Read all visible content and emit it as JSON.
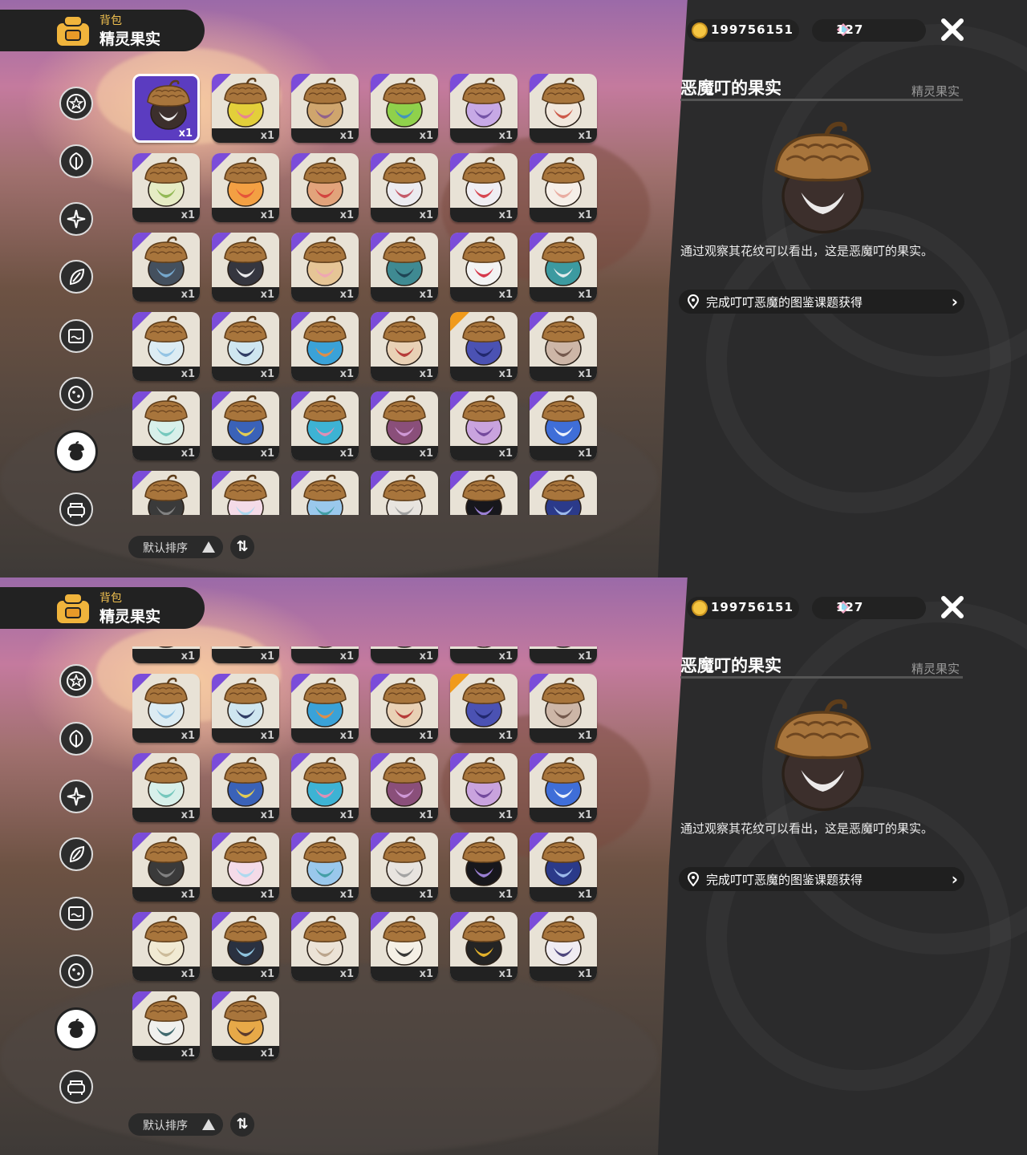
{
  "header": {
    "sub_label": "背包",
    "title": "精灵果实"
  },
  "currency": {
    "gold": "199756151",
    "gems": "127"
  },
  "tabs": [
    {
      "name": "tab-star",
      "icon": "star-badge-icon"
    },
    {
      "name": "tab-leaf",
      "icon": "leaf-icon"
    },
    {
      "name": "tab-spark",
      "icon": "sparkle-icon"
    },
    {
      "name": "tab-plant",
      "icon": "plant-icon"
    },
    {
      "name": "tab-scroll",
      "icon": "scroll-icon"
    },
    {
      "name": "tab-egg",
      "icon": "egg-icon"
    },
    {
      "name": "tab-fruit",
      "icon": "acorn-icon",
      "active": true
    },
    {
      "name": "tab-furniture",
      "icon": "sofa-icon"
    }
  ],
  "sort": {
    "label": "默认排序",
    "toggle": "⇅"
  },
  "detail": {
    "name": "恶魔叮的果实",
    "category": "精灵果实",
    "description": "通过观察其花纹可以看出，这是恶魔叮的果实。",
    "source": "完成叮叮恶魔的图鉴课题获得"
  },
  "items": [
    {
      "body": "#3c2f2c",
      "accent": "#ffffff",
      "corner": "none",
      "qty": "x1"
    },
    {
      "body": "#e3cf3a",
      "accent": "#e77c9a",
      "corner": "purple",
      "qty": "x1"
    },
    {
      "body": "#cfa56d",
      "accent": "#8a5a8e",
      "corner": "purple",
      "qty": "x1"
    },
    {
      "body": "#8fd14b",
      "accent": "#3a8dc9",
      "corner": "purple",
      "qty": "x1"
    },
    {
      "body": "#c7a9e6",
      "accent": "#6b4aa0",
      "corner": "purple",
      "qty": "x1"
    },
    {
      "body": "#f1e7dc",
      "accent": "#c94a3a",
      "corner": "purple",
      "qty": "x1"
    },
    {
      "body": "#e6ecc4",
      "accent": "#8ab44a",
      "corner": "purple",
      "qty": "x1"
    },
    {
      "body": "#f3a043",
      "accent": "#e34d38",
      "corner": "purple",
      "qty": "x1"
    },
    {
      "body": "#e2a37b",
      "accent": "#d23a3a",
      "corner": "purple",
      "qty": "x1"
    },
    {
      "body": "#ecebf0",
      "accent": "#c04a5a",
      "corner": "purple",
      "qty": "x1"
    },
    {
      "body": "#f0eef3",
      "accent": "#d43440",
      "corner": "purple",
      "qty": "x1"
    },
    {
      "body": "#f6efe8",
      "accent": "#e8a59a",
      "corner": "purple",
      "qty": "x1"
    },
    {
      "body": "#44505e",
      "accent": "#7bb0d8",
      "corner": "purple",
      "qty": "x1"
    },
    {
      "body": "#35363f",
      "accent": "#ffffff",
      "corner": "purple",
      "qty": "x1"
    },
    {
      "body": "#e6c596",
      "accent": "#f0a3b5",
      "corner": "purple",
      "qty": "x1"
    },
    {
      "body": "#3f8a92",
      "accent": "#1c3d4f",
      "corner": "purple",
      "qty": "x1"
    },
    {
      "body": "#f3f3f3",
      "accent": "#d3253a",
      "corner": "purple",
      "qty": "x1"
    },
    {
      "body": "#3c9aa0",
      "accent": "#f4f4f4",
      "corner": "purple",
      "qty": "x1"
    },
    {
      "body": "#dcecf3",
      "accent": "#8cc0e2",
      "corner": "purple",
      "qty": "x1"
    },
    {
      "body": "#cfe6f0",
      "accent": "#1f2a55",
      "corner": "purple",
      "qty": "x1"
    },
    {
      "body": "#3aa2d8",
      "accent": "#f08c3c",
      "corner": "purple",
      "qty": "x1"
    },
    {
      "body": "#e9d1b5",
      "accent": "#b02b2b",
      "corner": "purple",
      "qty": "x1"
    },
    {
      "body": "#4b52b3",
      "accent": "#1d2466",
      "corner": "gold",
      "qty": "x1"
    },
    {
      "body": "#cdb6a7",
      "accent": "#6a4f44",
      "corner": "purple",
      "qty": "x1"
    },
    {
      "body": "#d8f0ea",
      "accent": "#6bc3b8",
      "corner": "purple",
      "qty": "x1"
    },
    {
      "body": "#3a62b8",
      "accent": "#f5d84a",
      "corner": "purple",
      "qty": "x1"
    },
    {
      "body": "#3db3d4",
      "accent": "#f08cb3",
      "corner": "purple",
      "qty": "x1"
    },
    {
      "body": "#8a4f7a",
      "accent": "#d6a0e0",
      "corner": "purple",
      "qty": "x1"
    },
    {
      "body": "#c9a3de",
      "accent": "#6a4096",
      "corner": "purple",
      "qty": "x1"
    },
    {
      "body": "#3f6ed8",
      "accent": "#ffffff",
      "corner": "purple",
      "qty": "x1"
    },
    {
      "body": "#3a3a3a",
      "accent": "#8a8a8a",
      "corner": "purple",
      "qty": "x1"
    },
    {
      "body": "#f4dbe8",
      "accent": "#a6d8f0",
      "corner": "purple",
      "qty": "x1"
    },
    {
      "body": "#9ac8ec",
      "accent": "#3b9aa0",
      "corner": "purple",
      "qty": "x1"
    },
    {
      "body": "#e8e4df",
      "accent": "#9c9c9c",
      "corner": "purple",
      "qty": "x1"
    },
    {
      "body": "#17171c",
      "accent": "#a88be8",
      "corner": "purple",
      "qty": "x1"
    },
    {
      "body": "#2b3a8a",
      "accent": "#a8c8f5",
      "corner": "purple",
      "qty": "x1"
    },
    {
      "body": "#f1ead3",
      "accent": "#c8b694",
      "corner": "purple",
      "qty": "x1"
    },
    {
      "body": "#2a3140",
      "accent": "#9ad4ef",
      "corner": "purple",
      "qty": "x1"
    },
    {
      "body": "#ece3d6",
      "accent": "#b69d84",
      "corner": "purple",
      "qty": "x1"
    },
    {
      "body": "#f5f0e6",
      "accent": "#232323",
      "corner": "purple",
      "qty": "x1"
    },
    {
      "body": "#242424",
      "accent": "#f7c12c",
      "corner": "purple",
      "qty": "x1"
    },
    {
      "body": "#f0ecf2",
      "accent": "#3d3570",
      "corner": "purple",
      "qty": "x1"
    },
    {
      "body": "#f0f0ee",
      "accent": "#2c5a5f",
      "corner": "purple",
      "qty": "x1"
    },
    {
      "body": "#e7a948",
      "accent": "#4a2e2a",
      "corner": "purple",
      "qty": "x1"
    }
  ]
}
